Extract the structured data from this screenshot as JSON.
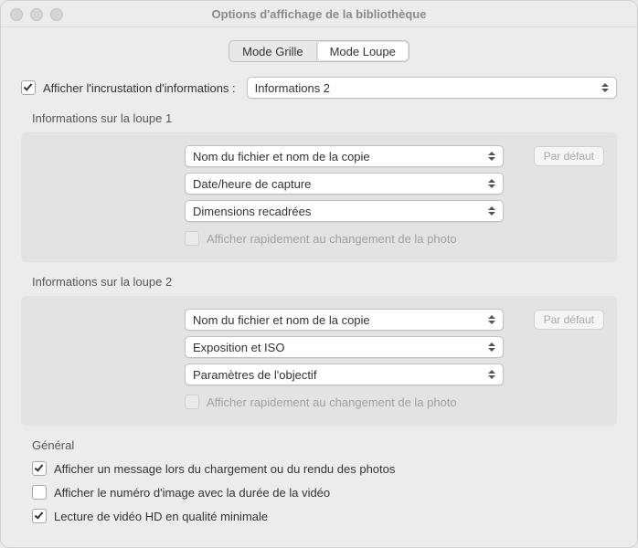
{
  "window": {
    "title": "Options d'affichage de la bibliothèque"
  },
  "tabs": {
    "grid": "Mode Grille",
    "loupe": "Mode Loupe"
  },
  "overlay": {
    "label": "Afficher l'incrustation d'informations :",
    "selected": "Informations 2"
  },
  "loupe1": {
    "title": "Informations sur la loupe 1",
    "field1": "Nom du fichier et nom de la copie",
    "field2": "Date/heure de capture",
    "field3": "Dimensions recadrées",
    "briefly": "Afficher rapidement au changement de la photo",
    "default_btn": "Par défaut"
  },
  "loupe2": {
    "title": "Informations sur la loupe 2",
    "field1": "Nom du fichier et nom de la copie",
    "field2": "Exposition et ISO",
    "field3": "Paramètres de l'objectif",
    "briefly": "Afficher rapidement au changement de la photo",
    "default_btn": "Par défaut"
  },
  "general": {
    "title": "Général",
    "opt1": "Afficher un message lors du chargement ou du rendu des photos",
    "opt2": "Afficher le numéro d'image avec la durée de la vidéo",
    "opt3": "Lecture de vidéo HD en qualité minimale"
  }
}
